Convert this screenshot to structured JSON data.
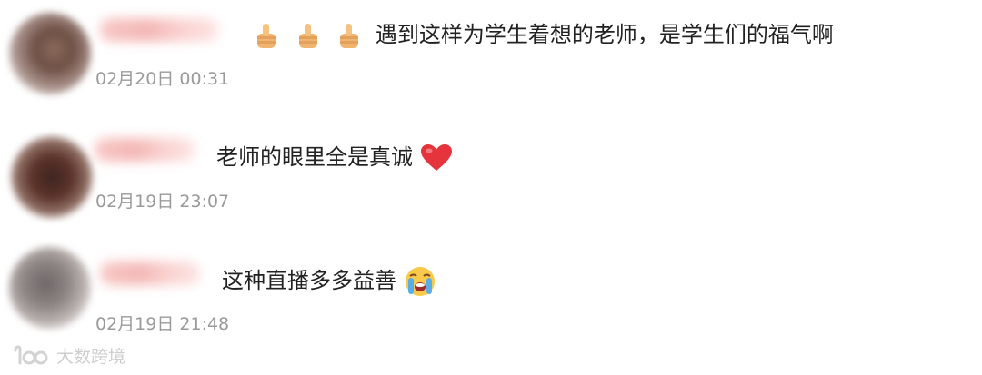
{
  "comments": [
    {
      "text": "遇到这样为学生着想的老师，是学生们的福气啊",
      "emojis": [
        "thumbs-up",
        "thumbs-up",
        "thumbs-up"
      ],
      "timestamp": "02月20日 00:31"
    },
    {
      "text": "老师的眼里全是真诚",
      "emojis": [
        "red-heart"
      ],
      "timestamp": "02月19日 23:07"
    },
    {
      "text": "这种直播多多益善",
      "emojis": [
        "crying-face"
      ],
      "timestamp": "02月19日 21:48"
    }
  ],
  "watermark": {
    "brand_text": "大数跨境"
  },
  "colors": {
    "text": "#222222",
    "timestamp": "#9a9a9a",
    "heart": "#e5343c",
    "thumb": "#f0b46e"
  }
}
